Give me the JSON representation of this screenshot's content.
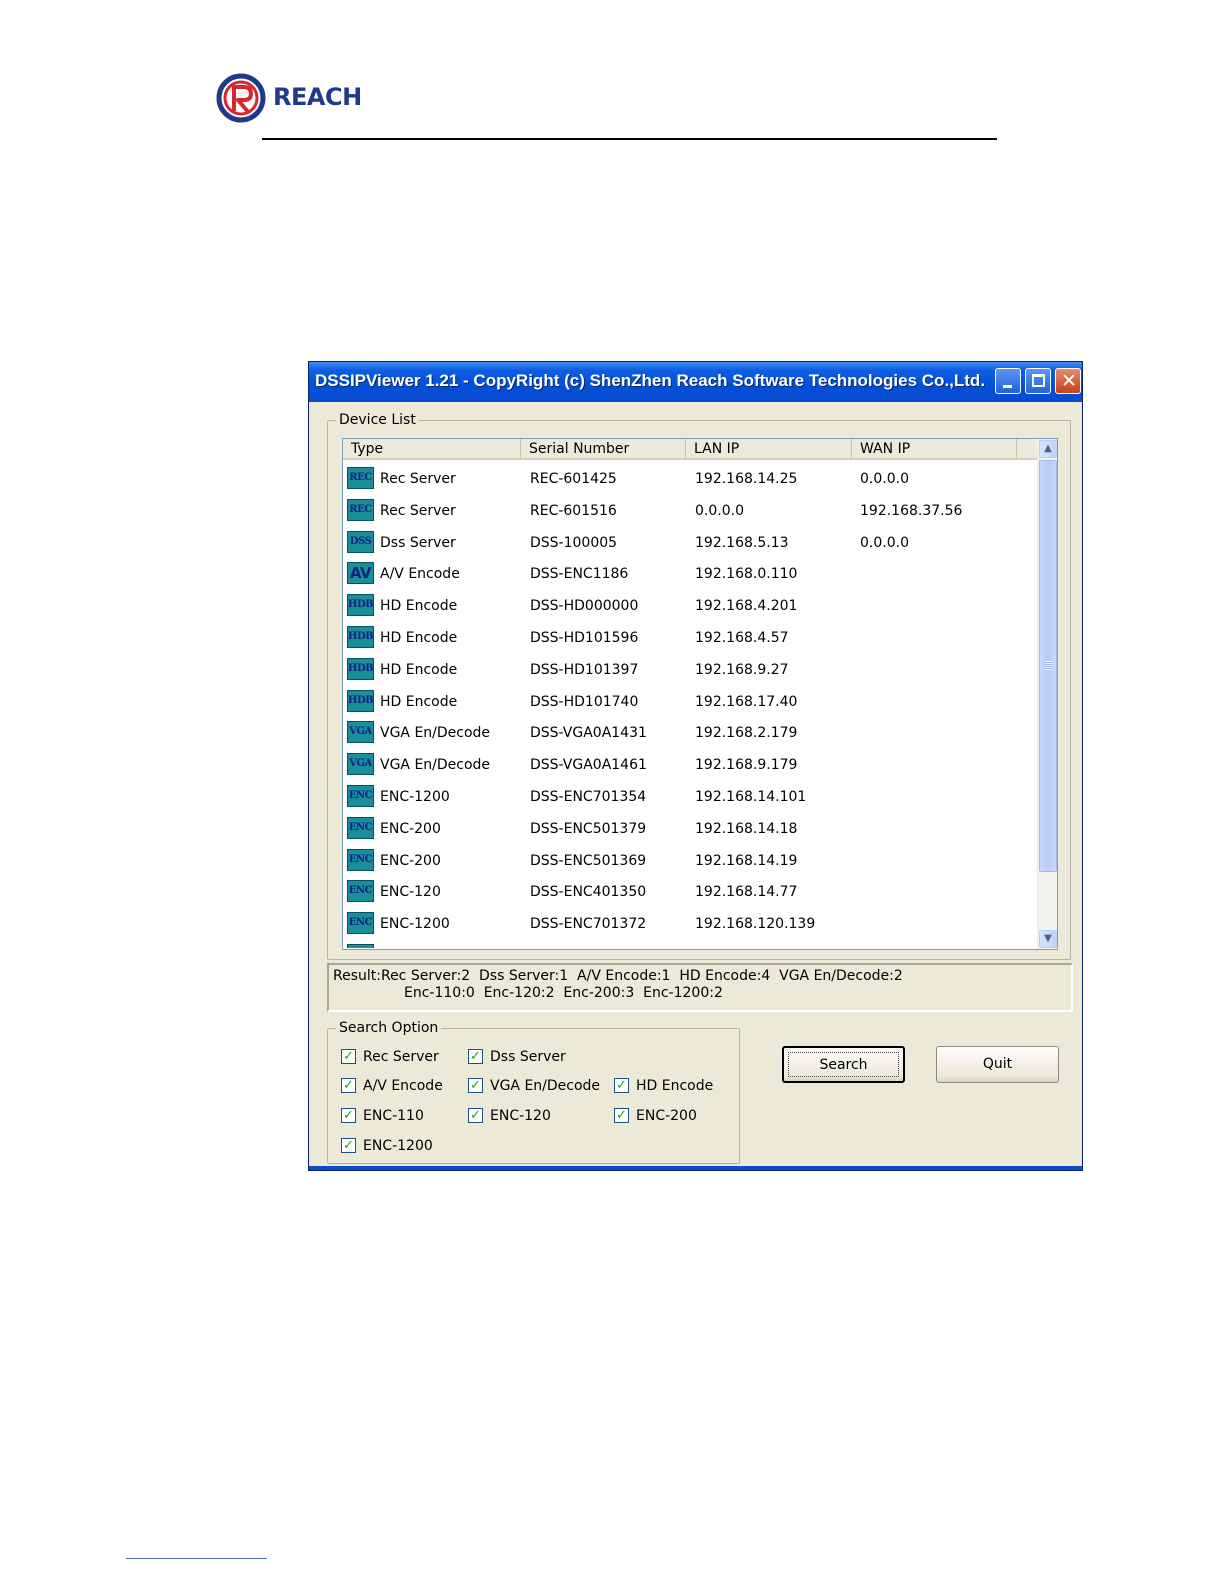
{
  "logo": {
    "text": "REACH"
  },
  "window": {
    "title": "DSSIPViewer 1.21 - CopyRight (c) ShenZhen Reach Software Technologies Co.,Ltd.",
    "controls": {
      "close_glyph": "✕"
    }
  },
  "device_list": {
    "legend": "Device List",
    "columns": [
      "Type",
      "Serial Number",
      "LAN IP",
      "WAN IP"
    ],
    "rows": [
      {
        "icon": "REC",
        "type": "Rec Server",
        "serial": "REC-601425",
        "lan": "192.168.14.25",
        "wan": "0.0.0.0"
      },
      {
        "icon": "REC",
        "type": "Rec Server",
        "serial": "REC-601516",
        "lan": "0.0.0.0",
        "wan": "192.168.37.56"
      },
      {
        "icon": "DSS",
        "type": "Dss Server",
        "serial": "DSS-100005",
        "lan": "192.168.5.13",
        "wan": "0.0.0.0"
      },
      {
        "icon": "AV",
        "type": "A/V Encode",
        "serial": "DSS-ENC1186",
        "lan": "192.168.0.110",
        "wan": ""
      },
      {
        "icon": "HDB",
        "type": "HD Encode",
        "serial": "DSS-HD000000",
        "lan": "192.168.4.201",
        "wan": ""
      },
      {
        "icon": "HDB",
        "type": "HD Encode",
        "serial": "DSS-HD101596",
        "lan": "192.168.4.57",
        "wan": ""
      },
      {
        "icon": "HDB",
        "type": "HD Encode",
        "serial": "DSS-HD101397",
        "lan": "192.168.9.27",
        "wan": ""
      },
      {
        "icon": "HDB",
        "type": "HD Encode",
        "serial": "DSS-HD101740",
        "lan": "192.168.17.40",
        "wan": ""
      },
      {
        "icon": "VGA",
        "type": "VGA En/Decode",
        "serial": "DSS-VGA0A1431",
        "lan": "192.168.2.179",
        "wan": ""
      },
      {
        "icon": "VGA",
        "type": "VGA En/Decode",
        "serial": "DSS-VGA0A1461",
        "lan": "192.168.9.179",
        "wan": ""
      },
      {
        "icon": "ENC",
        "type": "ENC-1200",
        "serial": "DSS-ENC701354",
        "lan": "192.168.14.101",
        "wan": ""
      },
      {
        "icon": "ENC",
        "type": "ENC-200",
        "serial": "DSS-ENC501379",
        "lan": "192.168.14.18",
        "wan": ""
      },
      {
        "icon": "ENC",
        "type": "ENC-200",
        "serial": "DSS-ENC501369",
        "lan": "192.168.14.19",
        "wan": ""
      },
      {
        "icon": "ENC",
        "type": "ENC-120",
        "serial": "DSS-ENC401350",
        "lan": "192.168.14.77",
        "wan": ""
      },
      {
        "icon": "ENC",
        "type": "ENC-1200",
        "serial": "DSS-ENC701372",
        "lan": "192.168.120.139",
        "wan": ""
      }
    ],
    "scrollbar": {
      "up_glyph": "▲",
      "down_glyph": "▼"
    }
  },
  "result": {
    "line1": "Result:Rec Server:2  Dss Server:1  A/V Encode:1  HD Encode:4  VGA En/Decode:2",
    "line2": "Enc-110:0  Enc-120:2  Enc-200:3  Enc-1200:2"
  },
  "search_option": {
    "legend": "Search Option",
    "check_glyph": "✓",
    "options": [
      {
        "label": "Rec Server",
        "checked": true
      },
      {
        "label": "Dss Server",
        "checked": true
      },
      {
        "label": "A/V Encode",
        "checked": true
      },
      {
        "label": "VGA En/Decode",
        "checked": true
      },
      {
        "label": "HD Encode",
        "checked": true
      },
      {
        "label": "ENC-110",
        "checked": true
      },
      {
        "label": "ENC-120",
        "checked": true
      },
      {
        "label": "ENC-200",
        "checked": true
      },
      {
        "label": "ENC-1200",
        "checked": true
      }
    ]
  },
  "buttons": {
    "search": "Search",
    "quit": "Quit"
  },
  "colors": {
    "title_bar": "#0050d8",
    "dialog_bg": "#ece9d8",
    "icon_bg": "#1a8e9a",
    "icon_text": "#0b2380"
  }
}
